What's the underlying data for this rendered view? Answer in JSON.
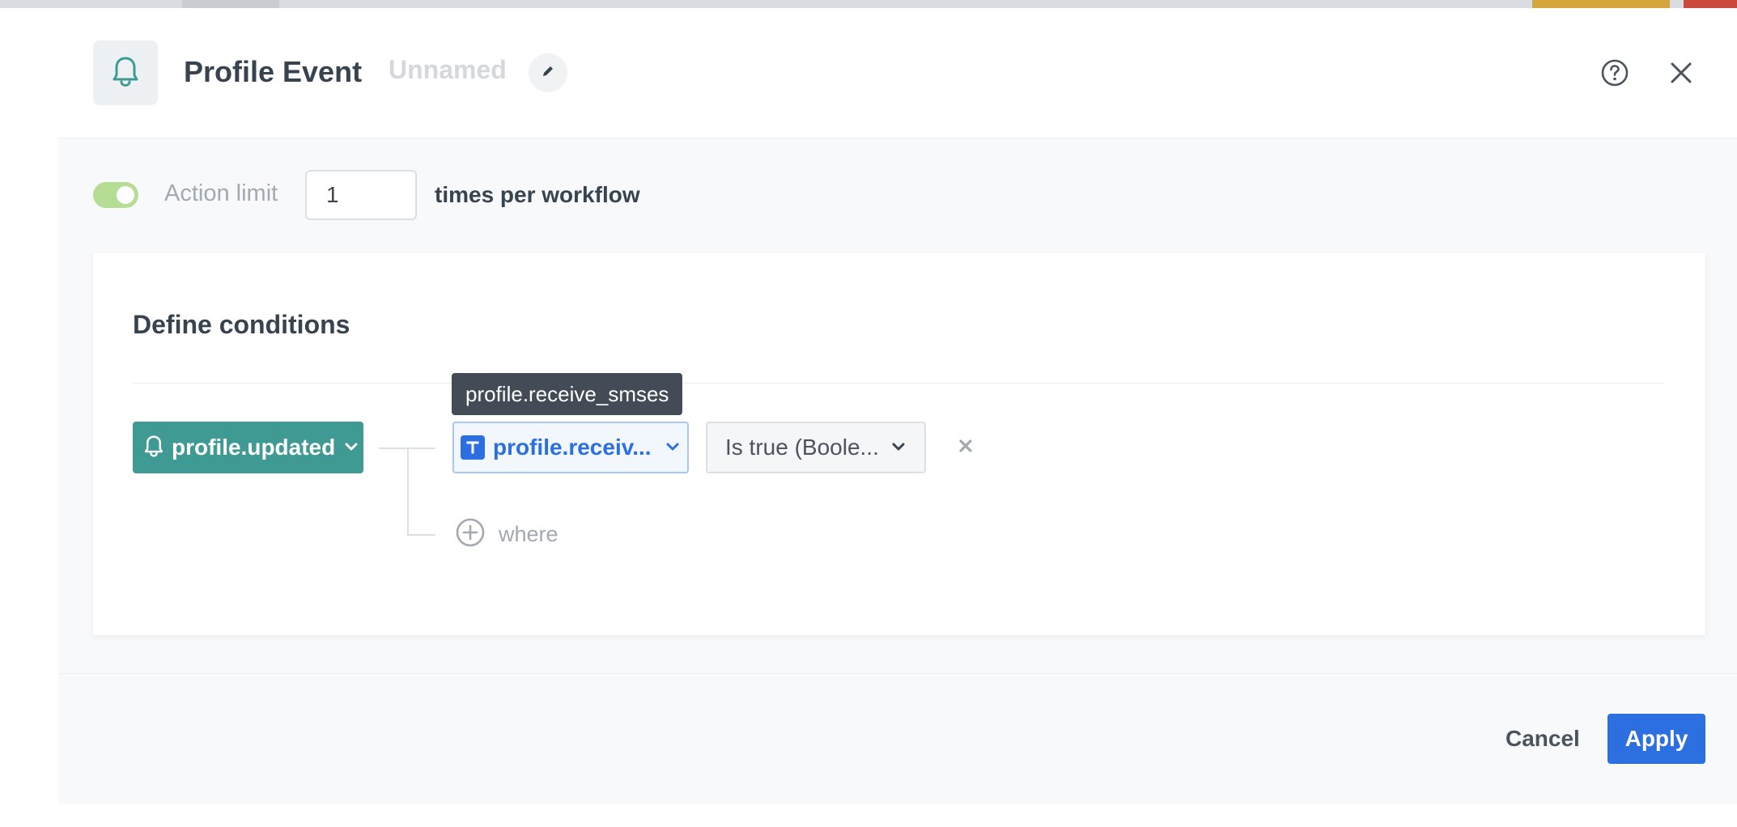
{
  "header": {
    "title": "Profile Event",
    "name": "Unnamed",
    "icon": "bell-icon"
  },
  "action_limit": {
    "enabled": true,
    "label": "Action limit",
    "value": "1",
    "suffix": "times per workflow"
  },
  "conditions": {
    "title": "Define conditions",
    "event": {
      "label": "profile.updated",
      "icon": "bell-icon"
    },
    "parameter": {
      "label": "profile.receiv...",
      "tooltip": "profile.receive_smses",
      "type_icon": "text-type-icon"
    },
    "operator": {
      "label": "Is true (Boole..."
    },
    "add_where_label": "where"
  },
  "footer": {
    "cancel_label": "Cancel",
    "apply_label": "Apply"
  },
  "colors": {
    "accent": "#2c6fe0",
    "event_teal": "#3f9a94",
    "toggle_green": "#b5dd94",
    "tooltip_bg": "#424b56"
  }
}
